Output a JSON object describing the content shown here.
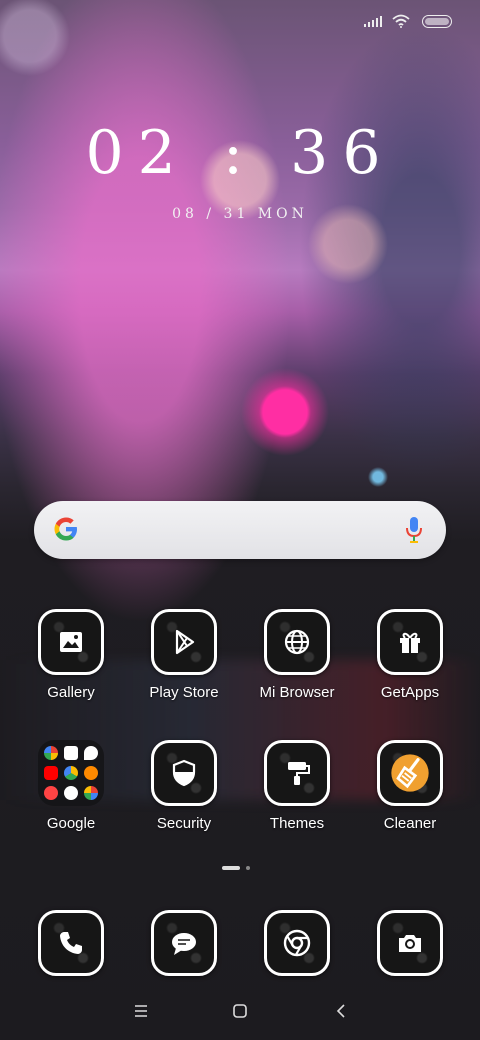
{
  "lockscreen": {
    "time": "02 : 36",
    "date": "08 / 31 MON"
  },
  "search": {
    "icon_left": "google-g-icon",
    "icon_right": "microphone-icon"
  },
  "apps_row1": [
    {
      "label": "Gallery",
      "icon": "image-icon"
    },
    {
      "label": "Play Store",
      "icon": "play-store-icon"
    },
    {
      "label": "Mi Browser",
      "icon": "globe-icon"
    },
    {
      "label": "GetApps",
      "icon": "gift-icon"
    }
  ],
  "apps_row2": [
    {
      "label": "Google",
      "icon": "folder-icon"
    },
    {
      "label": "Security",
      "icon": "shield-icon"
    },
    {
      "label": "Themes",
      "icon": "paint-roller-icon"
    },
    {
      "label": "Cleaner",
      "icon": "broom-icon"
    }
  ],
  "dock": [
    {
      "icon": "phone-icon"
    },
    {
      "icon": "message-icon"
    },
    {
      "icon": "chrome-icon"
    },
    {
      "icon": "camera-icon"
    }
  ],
  "colors": {
    "cleaner_accent": "#f0a030",
    "google_blue": "#4285F4",
    "google_red": "#EA4335",
    "google_yellow": "#FBBC05",
    "google_green": "#34A853"
  }
}
